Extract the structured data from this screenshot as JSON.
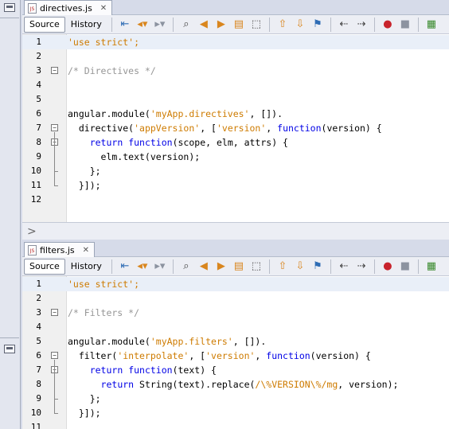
{
  "editor_top": {
    "file_tab": "directives.js",
    "views": {
      "source": "Source",
      "history": "History"
    },
    "code": [
      {
        "n": "1",
        "tokens": [
          {
            "t": "'use strict';",
            "c": "str"
          }
        ],
        "hl": true
      },
      {
        "n": "2",
        "tokens": []
      },
      {
        "n": "3",
        "tokens": [
          {
            "t": "/* Directives */",
            "c": "cm"
          }
        ],
        "fold": "start"
      },
      {
        "n": "4",
        "tokens": []
      },
      {
        "n": "5",
        "tokens": []
      },
      {
        "n": "6",
        "tokens": [
          {
            "t": "angular.module(",
            "c": "plain"
          },
          {
            "t": "'myApp.directives'",
            "c": "str"
          },
          {
            "t": ", []).",
            "c": "plain"
          }
        ]
      },
      {
        "n": "7",
        "tokens": [
          {
            "t": "  directive(",
            "c": "plain"
          },
          {
            "t": "'appVersion'",
            "c": "str"
          },
          {
            "t": ", [",
            "c": "plain"
          },
          {
            "t": "'version'",
            "c": "str"
          },
          {
            "t": ", ",
            "c": "plain"
          },
          {
            "t": "function",
            "c": "kw"
          },
          {
            "t": "(version) {",
            "c": "plain"
          }
        ],
        "fold": "start"
      },
      {
        "n": "8",
        "tokens": [
          {
            "t": "    ",
            "c": "plain"
          },
          {
            "t": "return",
            "c": "kw"
          },
          {
            "t": " ",
            "c": "plain"
          },
          {
            "t": "function",
            "c": "kw"
          },
          {
            "t": "(scope, elm, attrs) {",
            "c": "plain"
          }
        ],
        "fold": "start"
      },
      {
        "n": "9",
        "tokens": [
          {
            "t": "      elm.text(version);",
            "c": "plain"
          }
        ]
      },
      {
        "n": "10",
        "tokens": [
          {
            "t": "    };",
            "c": "plain"
          }
        ],
        "fold": "end"
      },
      {
        "n": "11",
        "tokens": [
          {
            "t": "  }]);",
            "c": "plain"
          }
        ],
        "fold": "end"
      },
      {
        "n": "12",
        "tokens": []
      }
    ]
  },
  "editor_bottom": {
    "file_tab": "filters.js",
    "views": {
      "source": "Source",
      "history": "History"
    },
    "code": [
      {
        "n": "1",
        "tokens": [
          {
            "t": "'use strict';",
            "c": "str"
          }
        ],
        "hl": true
      },
      {
        "n": "2",
        "tokens": []
      },
      {
        "n": "3",
        "tokens": [
          {
            "t": "/* Filters */",
            "c": "cm"
          }
        ],
        "fold": "start"
      },
      {
        "n": "4",
        "tokens": []
      },
      {
        "n": "5",
        "tokens": [
          {
            "t": "angular.module(",
            "c": "plain"
          },
          {
            "t": "'myApp.filters'",
            "c": "str"
          },
          {
            "t": ", []).",
            "c": "plain"
          }
        ]
      },
      {
        "n": "6",
        "tokens": [
          {
            "t": "  filter(",
            "c": "plain"
          },
          {
            "t": "'interpolate'",
            "c": "str"
          },
          {
            "t": ", [",
            "c": "plain"
          },
          {
            "t": "'version'",
            "c": "str"
          },
          {
            "t": ", ",
            "c": "plain"
          },
          {
            "t": "function",
            "c": "kw"
          },
          {
            "t": "(version) {",
            "c": "plain"
          }
        ],
        "fold": "start"
      },
      {
        "n": "7",
        "tokens": [
          {
            "t": "    ",
            "c": "plain"
          },
          {
            "t": "return",
            "c": "kw"
          },
          {
            "t": " ",
            "c": "plain"
          },
          {
            "t": "function",
            "c": "kw"
          },
          {
            "t": "(text) {",
            "c": "plain"
          }
        ],
        "fold": "start"
      },
      {
        "n": "8",
        "tokens": [
          {
            "t": "      ",
            "c": "plain"
          },
          {
            "t": "return",
            "c": "kw"
          },
          {
            "t": " String(text).replace(",
            "c": "plain"
          },
          {
            "t": "/\\%VERSION\\%/mg",
            "c": "str"
          },
          {
            "t": ", version);",
            "c": "plain"
          }
        ]
      },
      {
        "n": "9",
        "tokens": [
          {
            "t": "    };",
            "c": "plain"
          }
        ],
        "fold": "end"
      },
      {
        "n": "10",
        "tokens": [
          {
            "t": "  }]);",
            "c": "plain"
          }
        ],
        "fold": "end"
      },
      {
        "n": "11",
        "tokens": []
      }
    ]
  },
  "toolbar_icons": [
    "last-edit-icon",
    "back-icon",
    "forward-icon",
    "find-icon",
    "find-prev-icon",
    "find-next-icon",
    "toggle-highlight-icon",
    "select-icon",
    "prev-bookmark-icon",
    "next-bookmark-icon",
    "toggle-bookmark-icon",
    "shift-left-icon",
    "shift-right-icon",
    "record-macro-icon",
    "stop-macro-icon",
    "comment-icon"
  ],
  "colors": {
    "string": "#ce7b00",
    "keyword": "#0000e6",
    "comment": "#969696",
    "highlight_line": "#e9eff8"
  }
}
